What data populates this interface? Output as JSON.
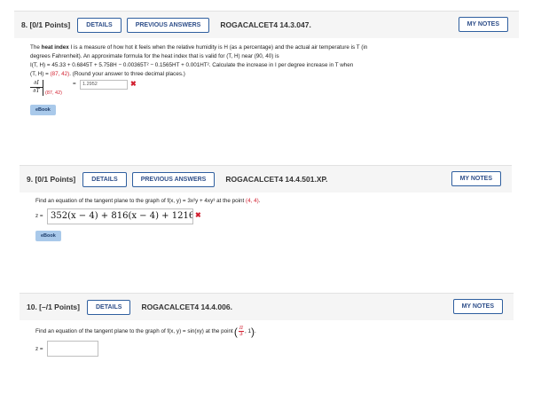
{
  "q8": {
    "number": "8. [0/1 Points]",
    "details": "DETAILS",
    "previous": "PREVIOUS ANSWERS",
    "code": "ROGACALCET4 14.3.047.",
    "mynotes": "MY NOTES",
    "line1a": "The ",
    "bold": "heat index",
    "line1b": " I is a measure of how hot it feels when the relative humidity is H (as a percentage) and the actual air temperature is T (in",
    "line2": "degrees Fahrenheit). An approximate formula for the heat index that is valid for (T, H) near (90, 40) is",
    "line3": "I(T, H) = 45.33 + 0.6845T + 5.758H − 0.00365T² − 0.1565HT + 0.001HT². Calculate the increase in I per degree increase in T when",
    "line4a": "(T, H) = ",
    "point": "(87, 42)",
    "line4b": ". (Round your answer to three decimal places.)",
    "frac_num": "∂I",
    "frac_den": "∂T",
    "eval_point": "(87, 42)",
    "equals": "=",
    "answer": "1.2952",
    "wrong": "✖",
    "ebook": "eBook"
  },
  "q9": {
    "number": "9. [0/1 Points]",
    "details": "DETAILS",
    "previous": "PREVIOUS ANSWERS",
    "code": "ROGACALCET4 14.4.501.XP.",
    "mynotes": "MY NOTES",
    "prompt_a": "Find an equation of the tangent plane to the graph of f(x, y) = ",
    "func": "3x²y + 4xy³",
    "prompt_b": " at the point ",
    "point": "(4, 4)",
    "prompt_c": ".",
    "zlabel": "z =",
    "answer": "352(x − 4) + 816(x − 4) + 1216",
    "wrong": "✖",
    "ebook": "eBook"
  },
  "q10": {
    "number": "10. [–/1 Points]",
    "details": "DETAILS",
    "code": "ROGACALCET4 14.4.006.",
    "mynotes": "MY NOTES",
    "prompt_a": "Find an equation of the tangent plane to the graph of f(x, y) = sin(xy) at the point ",
    "pi": "π",
    "den": "3",
    "one": "1",
    "prompt_c": ".",
    "zlabel": "z =",
    "answer": ""
  }
}
